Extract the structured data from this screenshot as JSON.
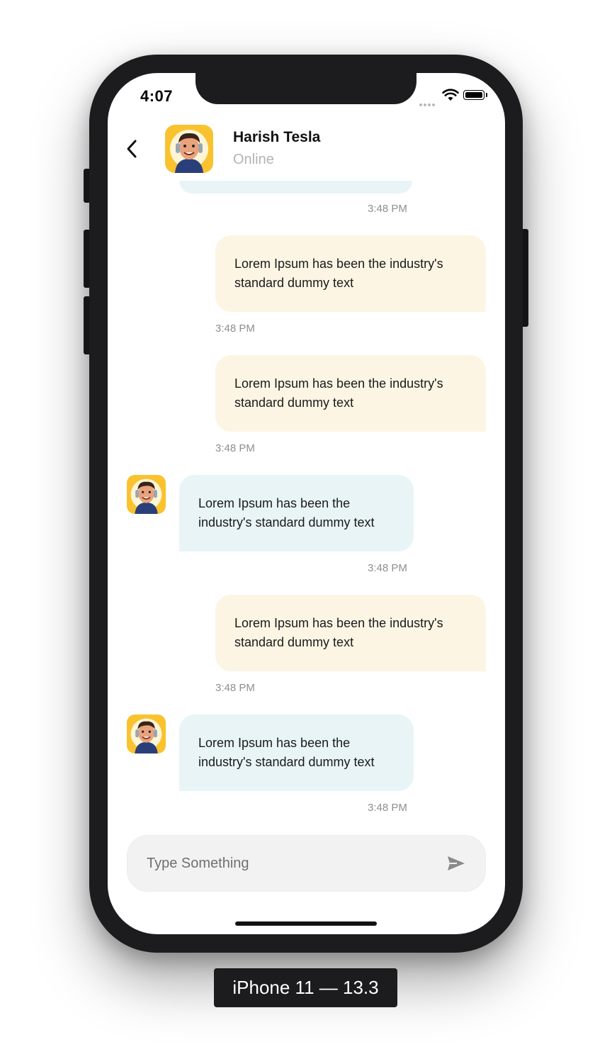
{
  "status_bar": {
    "time": "4:07"
  },
  "header": {
    "contact_name": "Harish Tesla",
    "contact_status": "Online"
  },
  "messages": [
    {
      "direction": "out",
      "text": "Lorem Ipsum has been the industry's standard dummy text",
      "time": "3:48 PM"
    },
    {
      "direction": "out",
      "text": "Lorem Ipsum has been the industry's standard dummy text",
      "time": "3:48 PM"
    },
    {
      "direction": "in",
      "text": "Lorem Ipsum has been the industry's standard dummy text",
      "time": "3:48 PM"
    },
    {
      "direction": "out",
      "text": "Lorem Ipsum has been the industry's standard dummy text",
      "time": "3:48 PM"
    },
    {
      "direction": "in",
      "text": "Lorem Ipsum has been the industry's standard dummy text",
      "time": "3:48 PM"
    }
  ],
  "previous_message_time": "3:48 PM",
  "composer": {
    "placeholder": "Type Something"
  },
  "device_label": "iPhone 11 — 13.3",
  "colors": {
    "outgoing_bubble": "#fdf5e4",
    "incoming_bubble": "#e9f4f7",
    "avatar_frame": "#f9c22e"
  },
  "icons": {
    "back": "chevron-left-icon",
    "send": "send-icon",
    "avatar": "avatar-illustration"
  }
}
